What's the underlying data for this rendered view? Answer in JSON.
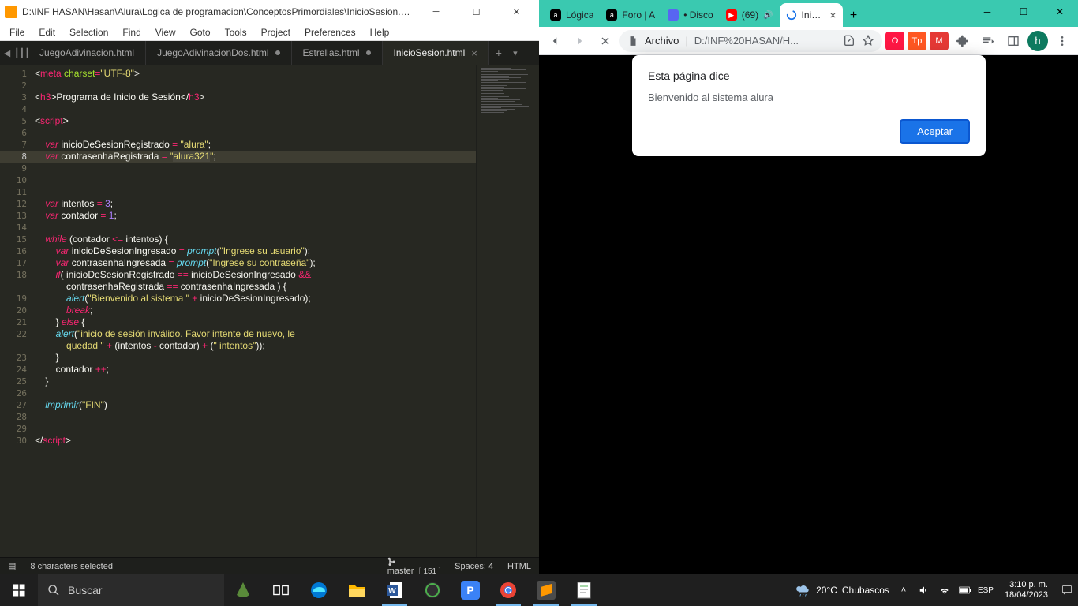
{
  "sublime": {
    "title": "D:\\INF HASAN\\Hasan\\Alura\\Logica de programacion\\ConceptosPrimordiales\\InicioSesion.htm...",
    "menu": [
      "File",
      "Edit",
      "Selection",
      "Find",
      "View",
      "Goto",
      "Tools",
      "Project",
      "Preferences",
      "Help"
    ],
    "tabs": [
      {
        "label": "JuegoAdivinacion.html",
        "active": false,
        "dirty": false
      },
      {
        "label": "JuegoAdivinacionDos.html",
        "active": false,
        "dirty": true
      },
      {
        "label": "Estrellas.html",
        "active": false,
        "dirty": true
      },
      {
        "label": "InicioSesion.html",
        "active": true,
        "dirty": false
      }
    ],
    "status": {
      "selection": "8 characters selected",
      "branch": "master",
      "branch_count": "151",
      "spaces": "Spaces: 4",
      "syntax": "HTML"
    },
    "highlight_line": 8,
    "selected_text": "alura321",
    "line_count": 30
  },
  "chrome": {
    "tabs": [
      {
        "label": "Lógica",
        "fav_bg": "#000",
        "fav_txt": "a"
      },
      {
        "label": "Foro | A",
        "fav_bg": "#000",
        "fav_txt": "a"
      },
      {
        "label": "• Disco",
        "fav_bg": "#5865f2",
        "fav_txt": ""
      },
      {
        "label": "(69)",
        "fav_bg": "#ff0000",
        "fav_txt": "▶",
        "audio": true
      },
      {
        "label": "Inicio",
        "fav_bg": "#fff",
        "fav_txt": "",
        "active": true,
        "spinner": true
      }
    ],
    "omnibox": {
      "scheme": "Archivo",
      "url": "D:/INF%20HASAN/H..."
    },
    "dialog": {
      "title": "Esta página dice",
      "message": "Bienvenido al sistema alura",
      "ok": "Aceptar"
    },
    "profile_initial": "h"
  },
  "taskbar": {
    "search_placeholder": "Buscar",
    "weather": {
      "temp": "20°C",
      "cond": "Chubascos"
    },
    "time": "3:10 p. m.",
    "date": "18/04/2023"
  }
}
